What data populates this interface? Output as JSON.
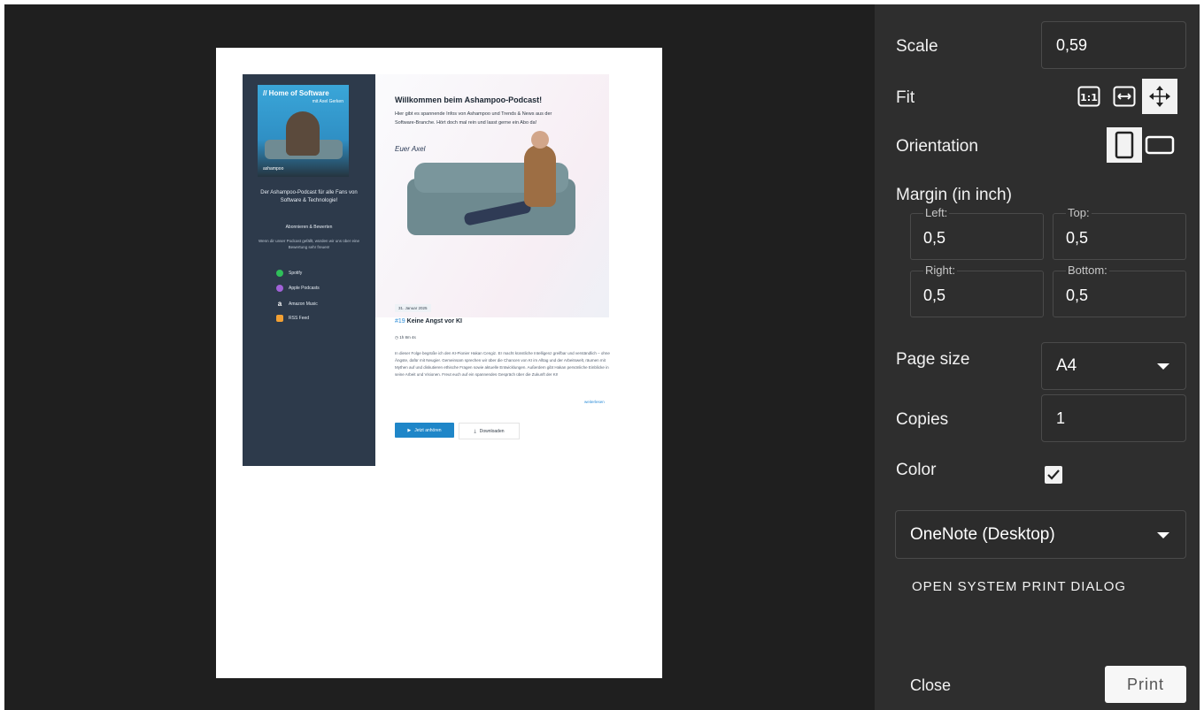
{
  "preview": {
    "sidebar": {
      "cover_title": "// Home of Software",
      "cover_subtitle": "mit Axel Gerken",
      "cover_brand": "ashampoo",
      "description": "Der Ashampoo-Podcast für alle Fans von Software & Technologie!",
      "subscribe_heading": "Abonnieren & Bewerten",
      "subscribe_text": "Wenn dir unser Podcast gefällt, würden wir uns über eine Bewertung sehr freuen!",
      "platforms": [
        {
          "label": "Spotify",
          "color": "#2fbf5a"
        },
        {
          "label": "Apple Podcasts",
          "color": "#a162d8"
        },
        {
          "label": "Amazon Music",
          "color": "#ffffff"
        },
        {
          "label": "RSS Feed",
          "color": "#f2a033"
        }
      ]
    },
    "main": {
      "headline": "Willkommen beim Ashampoo-Podcast!",
      "intro": "Hier gibt es spannende Infos von Ashampoo und Trends & News aus der Software-Branche. Hört doch mal rein und lasst gerne ein Abo da!",
      "signature": "Euer Axel",
      "date": "31. Januar 2025",
      "episode_number": "#19",
      "episode_title": "Keine Angst vor KI",
      "duration": "1h 8m 4s",
      "body": "In dieser Folge begrüße ich den KI-Pionier Hakan Cengiz. Er macht künstliche Intelligenz greifbar und verständlich – ohne Ängste, dafür mit Neugier. Gemeinsam sprechen wir über die Chancen von KI im Alltag und der Arbeitswelt, räumen mit Mythen auf und diskutieren ethische Fragen sowie aktuelle Entwicklungen. Außerdem gibt Hakan persönliche Einblicke in seine Arbeit und Visionen. Freut euch auf ein spannendes Gespräch über die Zukunft der KI!",
      "read_more": "weiterlesen",
      "play_button": "Jetzt anhören",
      "download_button": "Downloaden"
    }
  },
  "panel": {
    "scale_label": "Scale",
    "scale_value": "0,59",
    "fit_label": "Fit",
    "fit_options": [
      "1:1",
      "fit-width",
      "fit-page"
    ],
    "orientation_label": "Orientation",
    "margin_label": "Margin (in inch)",
    "margins": {
      "left_label": "Left:",
      "left": "0,5",
      "top_label": "Top:",
      "top": "0,5",
      "right_label": "Right:",
      "right": "0,5",
      "bottom_label": "Bottom:",
      "bottom": "0,5"
    },
    "page_size_label": "Page size",
    "page_size": "A4",
    "copies_label": "Copies",
    "copies": "1",
    "color_label": "Color",
    "color_checked": true,
    "printer": "OneNote (Desktop)",
    "system_dialog_link": "OPEN SYSTEM PRINT DIALOG",
    "close_label": "Close",
    "print_label": "Print"
  }
}
